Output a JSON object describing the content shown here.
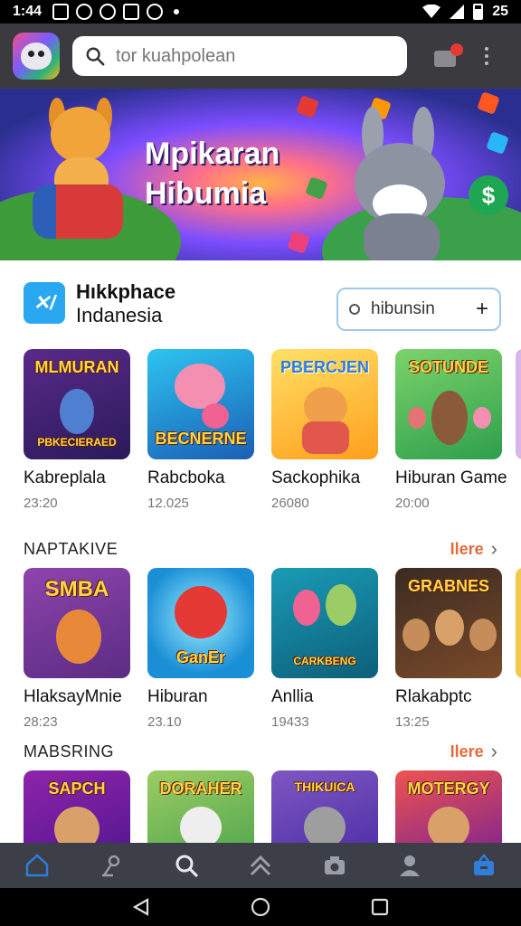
{
  "status_bar": {
    "time": "1:44",
    "right_text": "25"
  },
  "app_bar": {
    "search_placeholder": "tor kuahpolean",
    "search_value": ""
  },
  "banner": {
    "title_line1": "Mpikaran",
    "title_line2": "Hibumia",
    "coin_symbol": "$"
  },
  "store": {
    "logo_text": "✕/",
    "name_line1": "Hıkkphace",
    "name_line2": "Indanesia",
    "search_text": "hibunsin",
    "search_action": "+"
  },
  "featured": {
    "items": [
      {
        "thumb_caption": "MLMURAN",
        "thumb_caption2": "PBKECIERAED",
        "title": "Kabreplala",
        "meta": "23:20"
      },
      {
        "thumb_caption": "",
        "thumb_caption2": "BECNERNE",
        "title": "Rabcboka",
        "meta": "12.025"
      },
      {
        "thumb_caption": "PBERCJEN",
        "thumb_caption2": "",
        "title": "Sackophika",
        "meta": "26080"
      },
      {
        "thumb_caption": "SOTUNDE",
        "thumb_caption2": "",
        "title": "Hiburan Game",
        "meta": "20:00"
      }
    ]
  },
  "section2": {
    "title": "NAPTAKIVE",
    "more_label": "Ilere",
    "items": [
      {
        "thumb_caption": "SMBA",
        "thumb_caption2": "",
        "title": "HlaksayMnie",
        "meta": "28:23"
      },
      {
        "thumb_caption": "",
        "thumb_caption2": "GanEr",
        "title": "Hiburan",
        "meta": "23.10"
      },
      {
        "thumb_caption": "",
        "thumb_caption2": "CARKBENG",
        "title": "Anllia",
        "meta": "19433"
      },
      {
        "thumb_caption": "GRABNES",
        "thumb_caption2": "",
        "title": "Rlakabptc",
        "meta": "13:25"
      }
    ]
  },
  "section3": {
    "title": "MABSRING",
    "more_label": "Ilere",
    "items": [
      {
        "thumb_caption": "SAPCH"
      },
      {
        "thumb_caption": "DORAHER"
      },
      {
        "thumb_caption": "THIKUICA"
      },
      {
        "thumb_caption": "MOTERGY"
      }
    ]
  },
  "bottom_nav": [
    "home-icon",
    "pin-icon",
    "search-icon",
    "up-chevrons-icon",
    "camera-icon",
    "profile-icon",
    "store-icon"
  ],
  "colors": {
    "appbar": "#3b3b3f",
    "accent": "#2f7ed8",
    "more": "#e36b3a",
    "nav": "#3c3f47"
  }
}
